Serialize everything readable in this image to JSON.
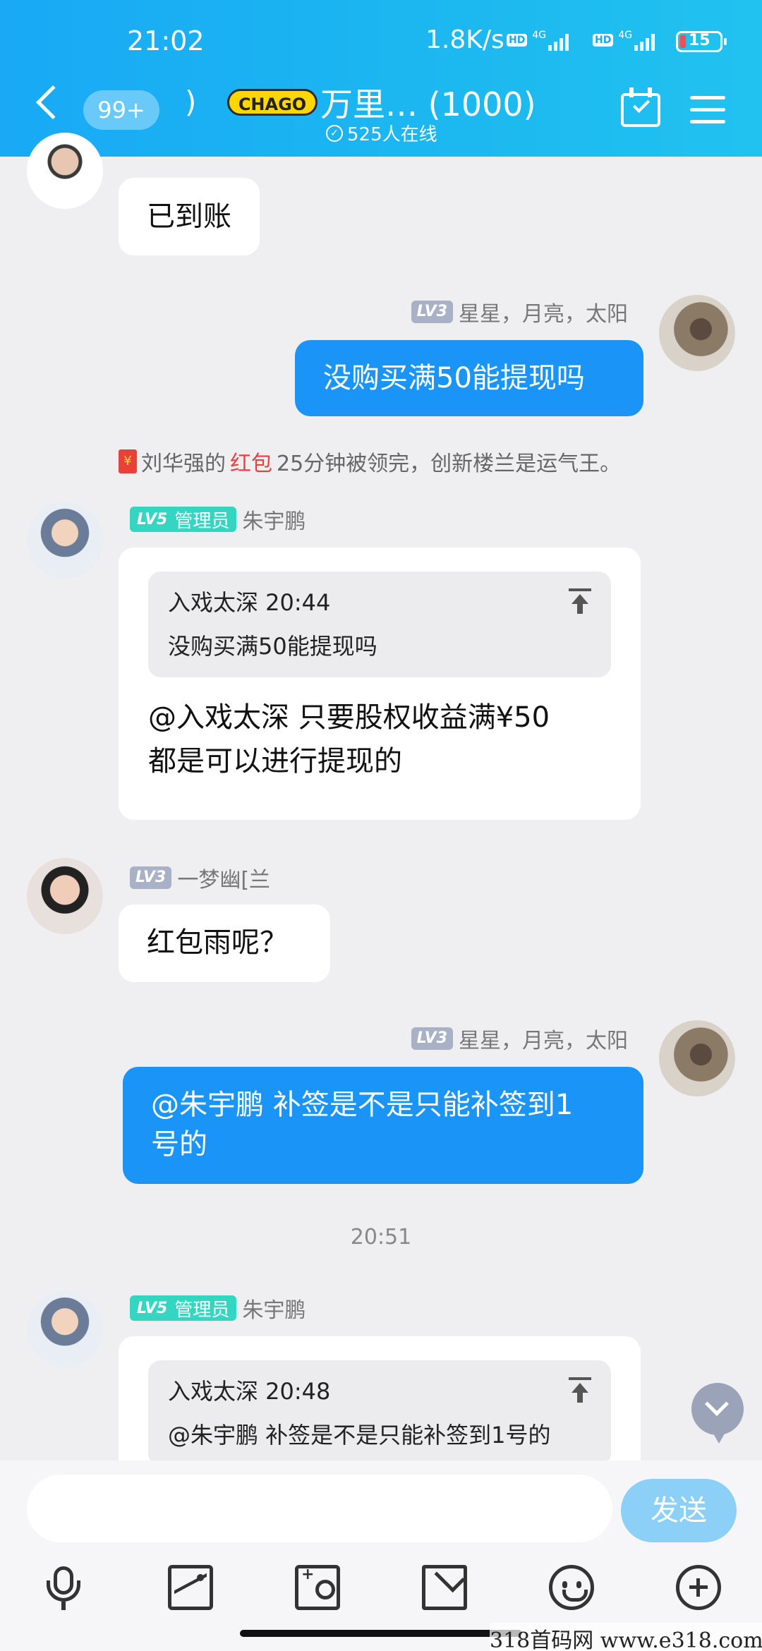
{
  "status_bar": {
    "time": "21:02",
    "net_rate": "1.8K/s",
    "hd_label": "HD",
    "net_type": "4G",
    "battery": "15"
  },
  "header": {
    "unread_badge": "99+",
    "group_logo": "CHAGO",
    "group_name": "万里…   (1000)",
    "online_count": "525人在线"
  },
  "messages": [
    {
      "side": "in",
      "text": "已到账"
    },
    {
      "side": "out",
      "level": "LV3",
      "name": "星星，月亮，太阳",
      "text": "没购买满50能提现吗"
    },
    {
      "side": "in",
      "level": "LV5",
      "role": "管理员",
      "name": "朱宇鹏",
      "quote_header": "入戏太深 20:44",
      "quote_text": "没购买满50能提现吗",
      "text_line1": "@入戏太深 只要股权收益满¥50",
      "text_line2": "都是可以进行提现的"
    },
    {
      "side": "in",
      "level": "LV3",
      "name": "一梦幽[兰",
      "text": "红包雨呢？"
    },
    {
      "side": "out",
      "level": "LV3",
      "name": "星星，月亮，太阳",
      "text_line1": "@朱宇鹏 补签是不是只能补签到1",
      "text_line2": "号的"
    },
    {
      "side": "in",
      "level": "LV5",
      "role": "管理员",
      "name": "朱宇鹏",
      "quote_header": "入戏太深 20:48",
      "quote_text": "@朱宇鹏 补签是不是只能补签到1号的"
    }
  ],
  "system_notice": {
    "prefix": "刘华强的",
    "highlight": "红包",
    "suffix": "25分钟被领完，创新楼兰是运气王。",
    "envelope_glyph": "¥"
  },
  "time_divider": "20:51",
  "composer": {
    "placeholder": "",
    "send_label": "发送"
  },
  "toolbar_icons": [
    "mic-icon",
    "image-icon",
    "camera-icon",
    "red-packet-icon",
    "emoji-icon",
    "plus-icon"
  ],
  "watermark": "318首码网  www.e318.com",
  "colors": {
    "header": "#19a9f5",
    "outgoing_bubble": "#1a95f7",
    "send_button": "#8ccff7",
    "admin_badge": "#35d6c1"
  }
}
